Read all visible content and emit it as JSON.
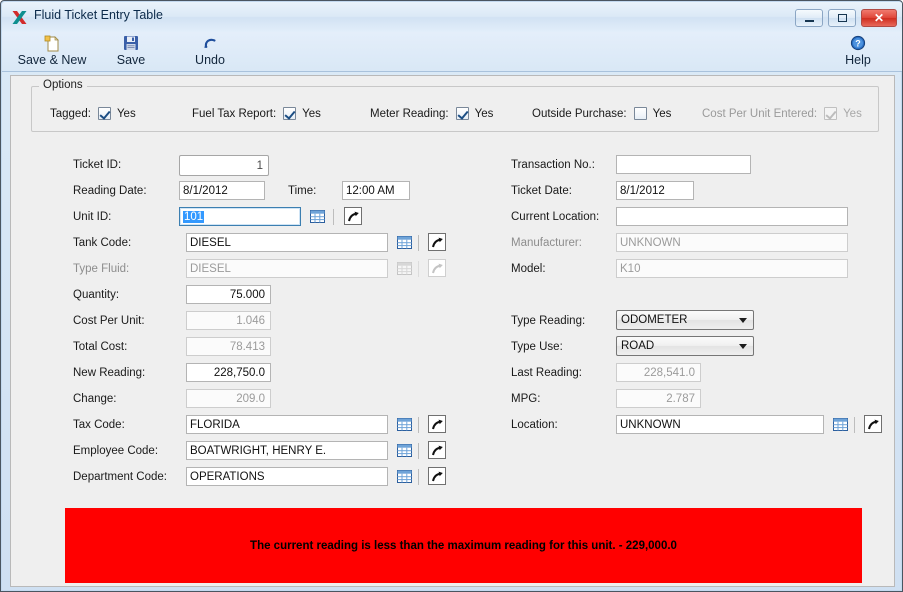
{
  "window": {
    "title": "Fluid Ticket Entry Table",
    "app_icon": "app-logo-icon",
    "minimize": "minimize-icon",
    "maximize": "maximize-icon",
    "close": "✕"
  },
  "toolbar": {
    "items": [
      {
        "label": "Save & New",
        "icon": "new-document-icon"
      },
      {
        "label": "Save",
        "icon": "floppy-disk-icon"
      },
      {
        "label": "Undo",
        "icon": "undo-arrow-icon"
      },
      {
        "label": "Help",
        "icon": "help-question-icon"
      }
    ]
  },
  "options": {
    "legend": "Options",
    "items": [
      {
        "label": "Tagged:",
        "value": "Yes",
        "checked": true,
        "disabled": false
      },
      {
        "label": "Fuel Tax Report:",
        "value": "Yes",
        "checked": true,
        "disabled": false
      },
      {
        "label": "Meter Reading:",
        "value": "Yes",
        "checked": true,
        "disabled": false
      },
      {
        "label": "Outside Purchase:",
        "value": "Yes",
        "checked": false,
        "disabled": false
      },
      {
        "label": "Cost Per Unit Entered:",
        "value": "Yes",
        "checked": true,
        "disabled": true
      }
    ]
  },
  "left_column": {
    "ticket_id": {
      "label": "Ticket ID:",
      "value": "1"
    },
    "reading_date": {
      "label": "Reading Date:",
      "value": "8/1/2012"
    },
    "time": {
      "label": "Time:",
      "value": "12:00 AM"
    },
    "unit_id": {
      "label": "Unit ID:",
      "value": "101"
    },
    "tank_code": {
      "label": "Tank Code:",
      "value": "DIESEL"
    },
    "type_fluid": {
      "label": "Type Fluid:",
      "value": "DIESEL"
    },
    "quantity": {
      "label": "Quantity:",
      "value": "75.000"
    },
    "cost_per_unit": {
      "label": "Cost Per Unit:",
      "value": "1.046"
    },
    "total_cost": {
      "label": "Total Cost:",
      "value": "78.413"
    },
    "new_reading": {
      "label": "New Reading:",
      "value": "228,750.0"
    },
    "change": {
      "label": "Change:",
      "value": "209.0"
    },
    "tax_code": {
      "label": "Tax Code:",
      "value": "FLORIDA"
    },
    "employee_code": {
      "label": "Employee Code:",
      "value": "BOATWRIGHT, HENRY E."
    },
    "department_code": {
      "label": "Department Code:",
      "value": "OPERATIONS"
    }
  },
  "right_column": {
    "transaction_no": {
      "label": "Transaction No.:",
      "value": ""
    },
    "ticket_date": {
      "label": "Ticket Date:",
      "value": "8/1/2012"
    },
    "current_location": {
      "label": "Current Location:",
      "value": ""
    },
    "manufacturer": {
      "label": "Manufacturer:",
      "value": "UNKNOWN"
    },
    "model": {
      "label": "Model:",
      "value": "K10"
    },
    "type_reading": {
      "label": "Type Reading:",
      "value": "ODOMETER"
    },
    "type_use": {
      "label": "Type Use:",
      "value": "ROAD"
    },
    "last_reading": {
      "label": "Last Reading:",
      "value": "228,541.0"
    },
    "mpg": {
      "label": "MPG:",
      "value": "2.787"
    },
    "location": {
      "label": "Location:",
      "value": "UNKNOWN"
    }
  },
  "icons": {
    "grid_lookup": "grid-lookup-icon",
    "jump_to": "jump-to-arrow-icon"
  },
  "error": {
    "message": "The current reading is less than the maximum reading for this unit.  -  229,000.0",
    "background_color": "#ff0000",
    "text_color": "#000000"
  }
}
